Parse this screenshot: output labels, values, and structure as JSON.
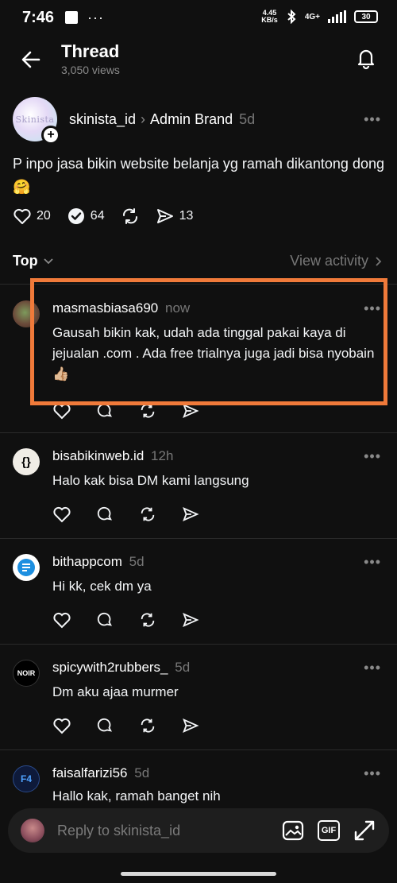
{
  "status_bar": {
    "time": "7:46",
    "dots": "···",
    "speed_top": "4.45",
    "speed_bottom": "KB/s",
    "network": "4G+",
    "battery": "30"
  },
  "header": {
    "title": "Thread",
    "views": "3,050 views"
  },
  "post": {
    "avatar_text": "Skinista",
    "username": "skinista_id",
    "category": "Admin Brand",
    "time": "5d",
    "text": "P inpo jasa bikin website belanja yg ramah dikantong dong 🤗",
    "likes": "20",
    "replies": "64",
    "shares": "13"
  },
  "sort": {
    "label": "Top",
    "view_activity": "View activity"
  },
  "replies": [
    {
      "username": "masmasbiasa690",
      "time": "now",
      "text": "Gausah bikin kak, udah ada tinggal pakai kaya di jejualan .com . Ada free trialnya juga jadi bisa nyobain 👍🏼"
    },
    {
      "username": "bisabikinweb.id",
      "time": "12h",
      "text": "Halo kak bisa DM kami langsung",
      "avatar_text": "{}"
    },
    {
      "username": "bithappcom",
      "time": "5d",
      "text": "Hi kk, cek dm ya"
    },
    {
      "username": "spicywith2rubbers_",
      "time": "5d",
      "text": "Dm aku ajaa murmer",
      "avatar_text": "NOIR"
    },
    {
      "username": "faisalfarizi56",
      "time": "5d",
      "text": "Hallo kak, ramah banget nih",
      "avatar_text": "F4"
    }
  ],
  "reply_bar": {
    "placeholder": "Reply to skinista_id",
    "gif_label": "GIF"
  },
  "colors": {
    "background": "#101010",
    "highlight": "#f07a3a",
    "muted": "#777777"
  }
}
